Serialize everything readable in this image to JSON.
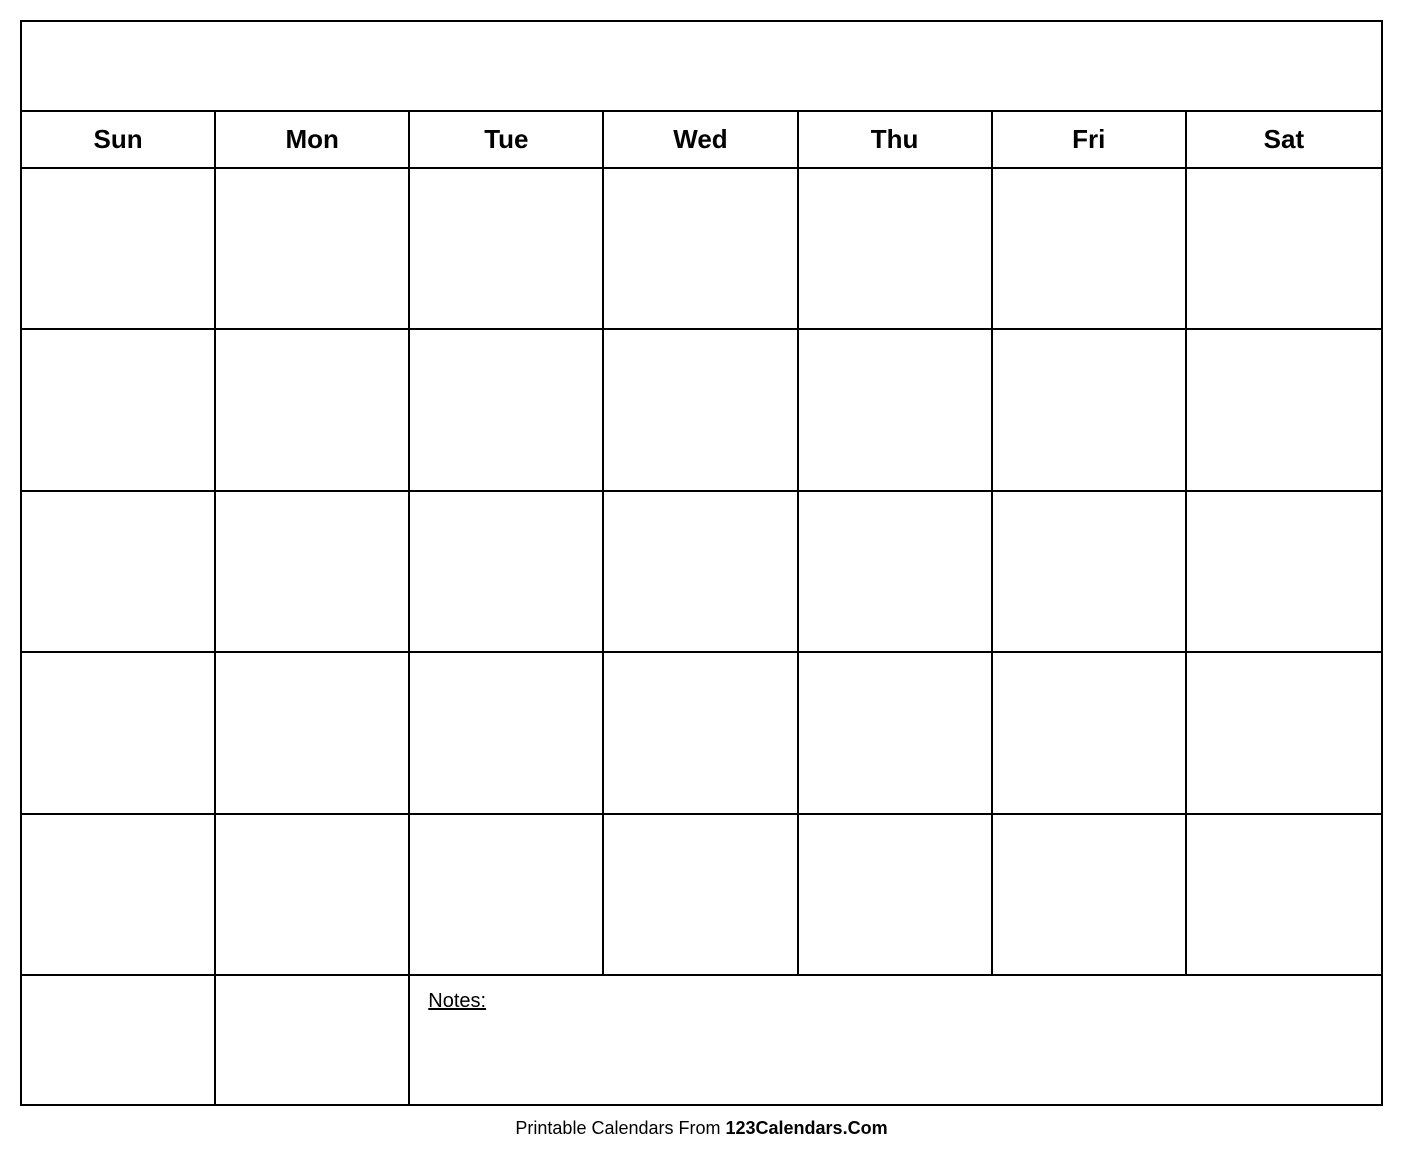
{
  "calendar": {
    "title": "",
    "days": [
      "Sun",
      "Mon",
      "Tue",
      "Wed",
      "Thu",
      "Fri",
      "Sat"
    ],
    "weeks": [
      [
        "",
        "",
        "",
        "",
        "",
        "",
        ""
      ],
      [
        "",
        "",
        "",
        "",
        "",
        "",
        ""
      ],
      [
        "",
        "",
        "",
        "",
        "",
        "",
        ""
      ],
      [
        "",
        "",
        "",
        "",
        "",
        "",
        ""
      ],
      [
        "",
        "",
        "",
        "",
        "",
        "",
        ""
      ]
    ],
    "notes_label": "Notes:",
    "notes_bottom_cells": [
      "",
      ""
    ]
  },
  "footer": {
    "text_normal": "Printable Calendars From ",
    "text_bold": "123Calendars.Com"
  }
}
